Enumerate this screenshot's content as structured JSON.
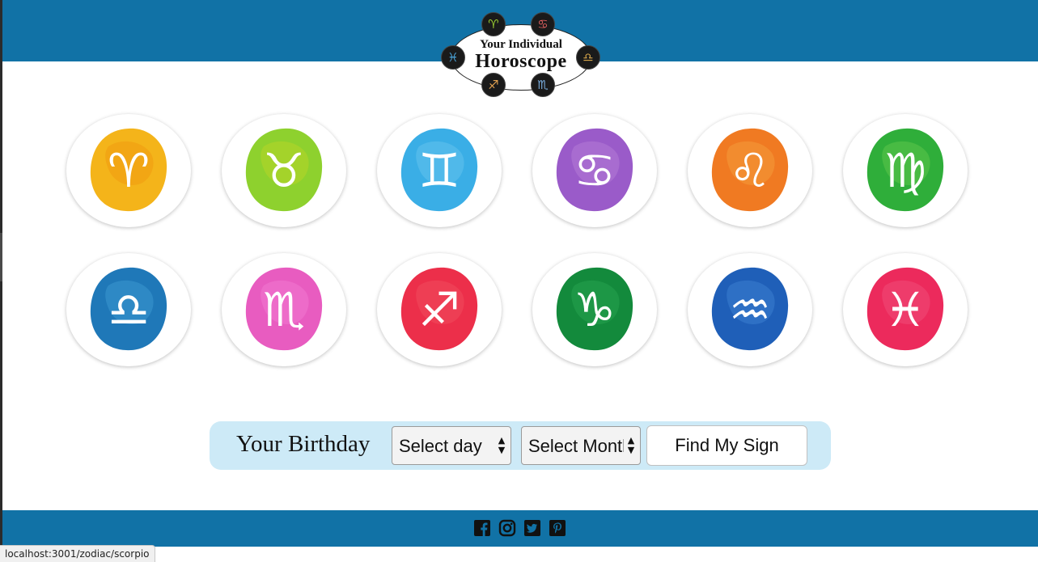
{
  "logo": {
    "line1": "Your Individual",
    "line2": "Horoscope",
    "badges": [
      {
        "symbol": "♈",
        "color": "#9acd32"
      },
      {
        "symbol": "♋",
        "color": "#e06060"
      },
      {
        "symbol": "♓",
        "color": "#4aa3d8"
      },
      {
        "symbol": "♎",
        "color": "#d4a44a"
      },
      {
        "symbol": "♐",
        "color": "#e0a050"
      },
      {
        "symbol": "♏",
        "color": "#7aaee0"
      }
    ]
  },
  "zodiac": [
    {
      "name": "aries",
      "symbol": "♈",
      "color": "#f4b41a",
      "color2": "#f09a10"
    },
    {
      "name": "taurus",
      "symbol": "♉",
      "color": "#8ed12e",
      "color2": "#b6d628"
    },
    {
      "name": "gemini",
      "symbol": "♊",
      "color": "#3aaee6",
      "color2": "#62c2ec"
    },
    {
      "name": "cancer",
      "symbol": "♋",
      "color": "#9a5bc9",
      "color2": "#b47ad6"
    },
    {
      "name": "leo",
      "symbol": "♌",
      "color": "#f07a22",
      "color2": "#f49a3a"
    },
    {
      "name": "virgo",
      "symbol": "♍",
      "color": "#2fae3a",
      "color2": "#5cc64a"
    },
    {
      "name": "libra",
      "symbol": "♎",
      "color": "#1f78b8",
      "color2": "#3a98d0"
    },
    {
      "name": "scorpio",
      "symbol": "♏",
      "color": "#e85cc0",
      "color2": "#f078d0"
    },
    {
      "name": "sagittarius",
      "symbol": "♐",
      "color": "#ec2f4a",
      "color2": "#f04a5c"
    },
    {
      "name": "capricorn",
      "symbol": "♑",
      "color": "#138a3c",
      "color2": "#26a24e"
    },
    {
      "name": "aquarius",
      "symbol": "♒",
      "color": "#1f5fb8",
      "color2": "#3a7ed0"
    },
    {
      "name": "pisces",
      "symbol": "♓",
      "color": "#ec2a5c",
      "color2": "#f04a78"
    }
  ],
  "form": {
    "label": "Your Birthday",
    "day_select": "Select day",
    "month_select": "Select Month",
    "submit": "Find My Sign"
  },
  "social": [
    "facebook-icon",
    "instagram-icon",
    "twitter-icon",
    "pinterest-icon"
  ],
  "status_url": "localhost:3001/zodiac/scorpio",
  "colors": {
    "header": "#1172a6",
    "form_bg": "#cdeaf7"
  }
}
